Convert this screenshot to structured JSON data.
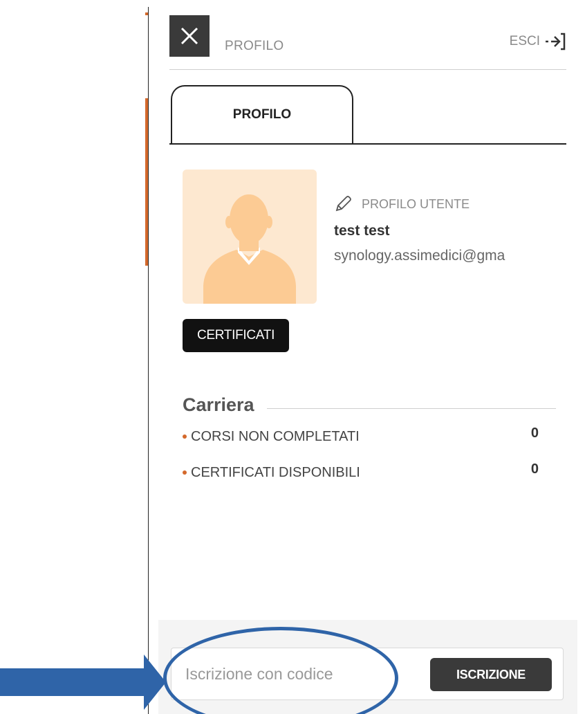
{
  "header": {
    "title": "PROFILO",
    "logout_label": "ESCI"
  },
  "tabs": [
    {
      "label": "PROFILO",
      "active": true
    }
  ],
  "profile": {
    "edit_label": "PROFILO UTENTE",
    "name": "test test",
    "email": "synology.assimedici@gma"
  },
  "certificates_button": "CERTIFICATI",
  "career": {
    "title": "Carriera",
    "stats": [
      {
        "label": "CORSI NON COMPLETATI",
        "value": "0"
      },
      {
        "label": "CERTIFICATI DISPONIBILI",
        "value": "0"
      }
    ]
  },
  "enroll": {
    "placeholder": "Iscrizione con codice",
    "value": "",
    "button_label": "ISCRIZIONE"
  },
  "colors": {
    "accent": "#d4692c",
    "dark_button": "#3a3a3a",
    "avatar_bg": "#fde8d0",
    "avatar_figure": "#fccb94",
    "annotation": "#2f64a8"
  },
  "icons": {
    "close": "close-icon",
    "logout": "logout-icon",
    "edit": "pencil-icon",
    "avatar": "user-silhouette-icon"
  }
}
